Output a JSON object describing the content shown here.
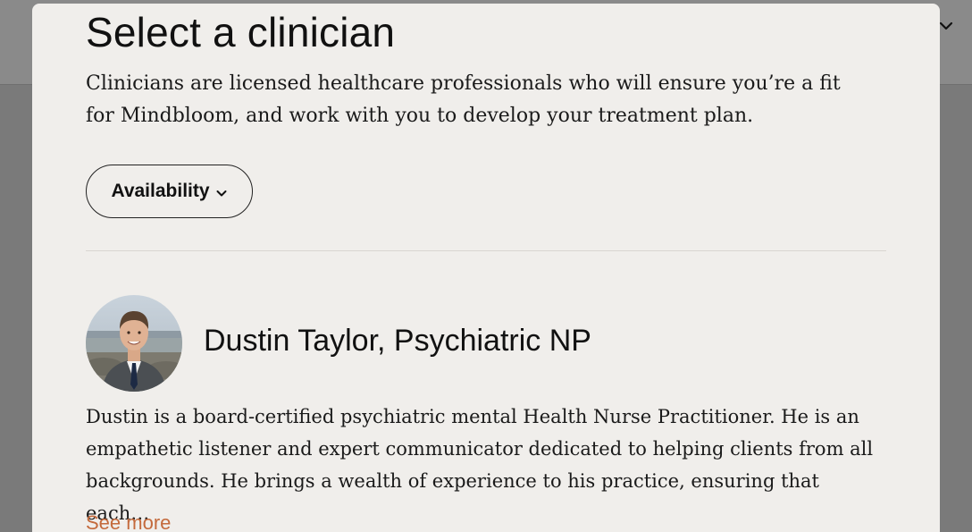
{
  "modal": {
    "title": "Select a clinician",
    "subtitle": "Clinicians are licensed healthcare professionals who will ensure you’re a fit for Mindbloom, and work with you to develop your treatment plan.",
    "filter": {
      "label": "Availability",
      "icon": "chevron-down-icon"
    }
  },
  "clinicians": [
    {
      "name": "Dustin Taylor, Psychiatric NP",
      "bio": "Dustin is a board-certified psychiatric mental Health Nurse Practitioner. He is an empathetic listener and expert communicator dedicated to helping clients from all backgrounds. He brings a wealth of experience to his practice, ensuring that each…",
      "see_more": "See more"
    }
  ],
  "colors": {
    "modal_bg": "#f0eeeb",
    "overlay": "#7a7a7a",
    "link": "#c46a3c",
    "text": "#111111"
  }
}
